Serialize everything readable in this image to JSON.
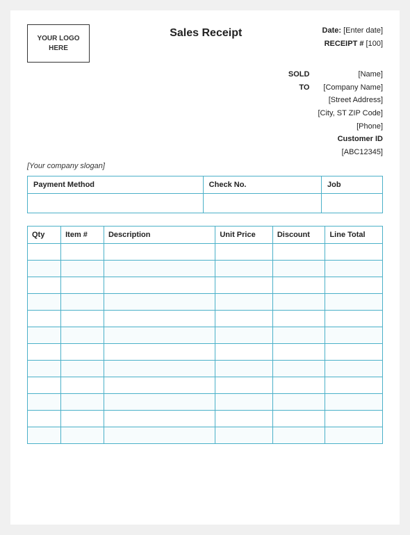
{
  "header": {
    "title": "Sales Receipt",
    "date_label": "Date:",
    "date_value": "[Enter date]",
    "receipt_label": "RECEIPT #",
    "receipt_value": "[100]",
    "logo_line1": "YOUR LOGO",
    "logo_line2": "HERE"
  },
  "sold_to": {
    "label_line1": "SOLD",
    "label_line2": "TO",
    "name": "[Name]",
    "company": "[Company Name]",
    "street": "[Street Address]",
    "city": "[City, ST  ZIP Code]",
    "phone": "[Phone]",
    "customer_id_label": "Customer ID",
    "customer_id_value": "[ABC12345]"
  },
  "slogan": "[Your company slogan]",
  "payment_table": {
    "headers": [
      "Payment Method",
      "Check No.",
      "Job"
    ],
    "row": [
      "",
      "",
      ""
    ]
  },
  "items_table": {
    "headers": [
      "Qty",
      "Item #",
      "Description",
      "Unit Price",
      "Discount",
      "Line Total"
    ],
    "rows": 12
  }
}
